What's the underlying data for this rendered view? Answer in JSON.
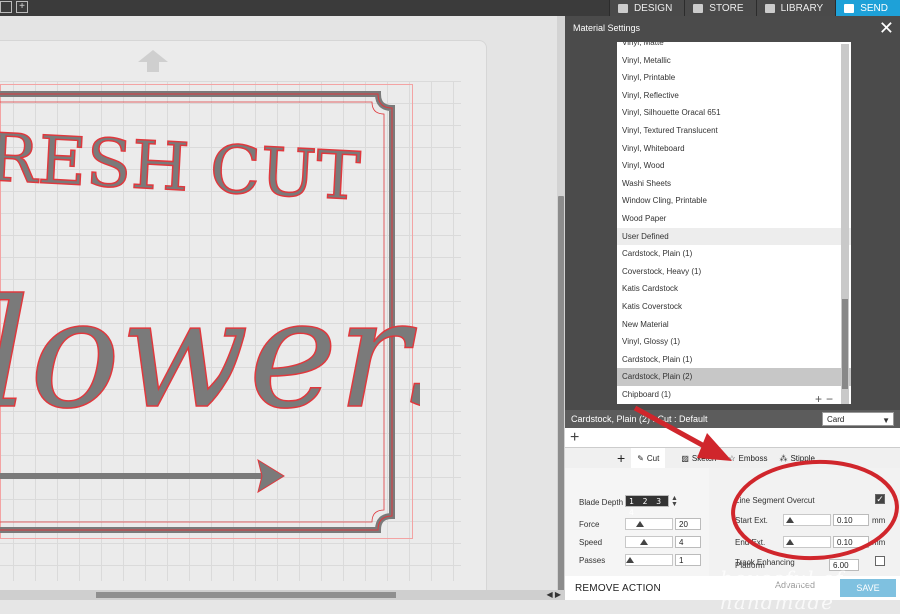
{
  "nav": {
    "tabs": [
      {
        "label": "DESIGN",
        "icon": "design-icon"
      },
      {
        "label": "STORE",
        "icon": "store-icon"
      },
      {
        "label": "LIBRARY",
        "icon": "library-icon"
      },
      {
        "label": "SEND",
        "icon": "send-icon",
        "active": true
      }
    ]
  },
  "artwork": {
    "line1": "RESH CUT",
    "line2": "lowers"
  },
  "panel": {
    "title": "Material Settings",
    "materials": [
      {
        "label": "Vinyl, Matte"
      },
      {
        "label": "Vinyl, Metallic"
      },
      {
        "label": "Vinyl, Printable"
      },
      {
        "label": "Vinyl, Reflective"
      },
      {
        "label": "Vinyl, Silhouette Oracal 651"
      },
      {
        "label": "Vinyl, Textured Translucent"
      },
      {
        "label": "Vinyl, Whiteboard"
      },
      {
        "label": "Vinyl, Wood"
      },
      {
        "label": "Washi Sheets"
      },
      {
        "label": "Window Cling, Printable"
      },
      {
        "label": "Wood Paper"
      },
      {
        "label": "User Defined",
        "group": true
      },
      {
        "label": "Cardstock, Plain (1)"
      },
      {
        "label": "Coverstock, Heavy (1)"
      },
      {
        "label": "Katis Cardstock"
      },
      {
        "label": "Katis Coverstock"
      },
      {
        "label": "New Material"
      },
      {
        "label": "Vinyl, Glossy (1)"
      },
      {
        "label": "Cardstock, Plain (1)"
      },
      {
        "label": "Cardstock, Plain (2)",
        "selected": true
      },
      {
        "label": "Chipboard (1)"
      }
    ],
    "list_add": "+",
    "list_remove": "−",
    "selected_title": "Cardstock, Plain (2) : Cut : Default",
    "tool_dropdown": "Card",
    "add_label": "+",
    "tabs": {
      "add": "+",
      "cut": "Cut",
      "sketch": "Sketch",
      "emboss": "Emboss",
      "stipple": "Stipple"
    },
    "settings": {
      "blade_depth_label": "Blade Depth",
      "blade_depth_value": "1 2 3 4",
      "force_label": "Force",
      "force_value": "20",
      "speed_label": "Speed",
      "speed_value": "4",
      "passes_label": "Passes",
      "passes_value": "1"
    },
    "advanced": {
      "line_segment_overcut": "Line Segment Overcut",
      "overcut_checked": "✓",
      "start_ext_label": "Start Ext.",
      "start_ext_value": "0.10",
      "end_ext_label": "End Ext.",
      "end_ext_value": "0.10",
      "unit": "mm",
      "track_enhancing": "Track Enhancing",
      "platform": "Platform",
      "platform_value": "6.00"
    },
    "footer": {
      "remove_action": "REMOVE ACTION",
      "advanced": "Advanced",
      "save": "SAVE"
    }
  },
  "watermark": "houseful of handmade",
  "colors": {
    "accent": "#1ea1d8",
    "annotation": "#d0262c",
    "cut_line": "#e0383d",
    "artwork_fill": "#7a7a7a"
  }
}
